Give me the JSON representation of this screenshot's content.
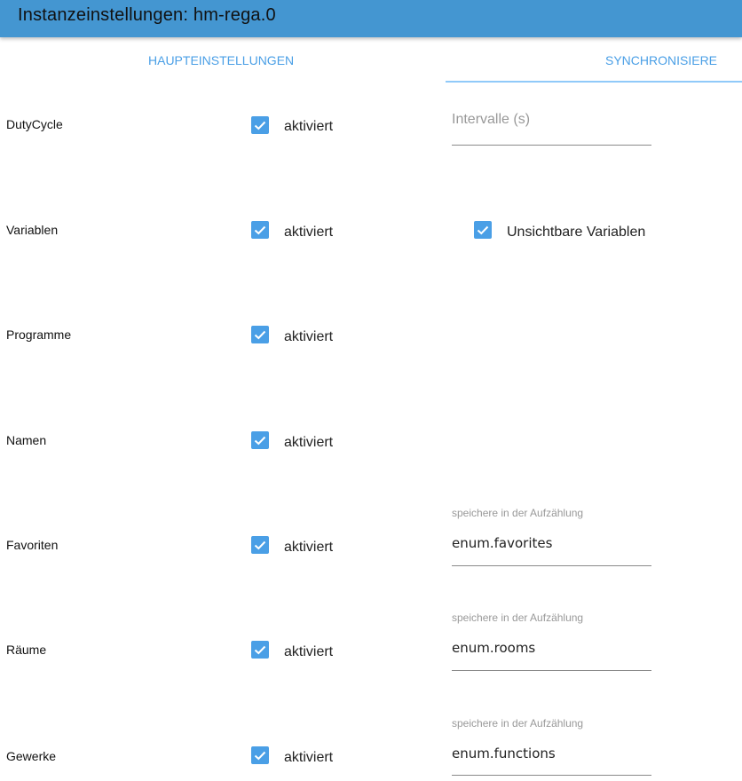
{
  "header": {
    "title": "Instanzeinstellungen: hm-rega.0"
  },
  "tabs": [
    {
      "label": "HAUPTEINSTELLUNGEN"
    },
    {
      "label": "SYNCHRONISIERE"
    }
  ],
  "rows": [
    {
      "label": "DutyCycle",
      "checkbox_label": "aktiviert",
      "checked": true
    },
    {
      "label": "Variablen",
      "checkbox_label": "aktiviert",
      "checked": true
    },
    {
      "label": "Programme",
      "checkbox_label": "aktiviert",
      "checked": true
    },
    {
      "label": "Namen",
      "checkbox_label": "aktiviert",
      "checked": true
    },
    {
      "label": "Favoriten",
      "checkbox_label": "aktiviert",
      "checked": true
    },
    {
      "label": "Räume",
      "checkbox_label": "aktiviert",
      "checked": true
    },
    {
      "label": "Gewerke",
      "checkbox_label": "aktiviert",
      "checked": true
    }
  ],
  "dutycycle_interval": {
    "placeholder": "Intervalle (s)"
  },
  "invisible_variables": {
    "label": "Unsichtbare Variablen",
    "checked": true
  },
  "enum_fields": [
    {
      "label": "speichere in der Aufzählung",
      "value": "enum.favorites"
    },
    {
      "label": "speichere in der Aufzählung",
      "value": "enum.rooms"
    },
    {
      "label": "speichere in der Aufzählung",
      "value": "enum.functions"
    }
  ],
  "colors": {
    "header": "#4496d1",
    "accent": "#4a9fe6",
    "tab_indicator": "#90caf9"
  }
}
